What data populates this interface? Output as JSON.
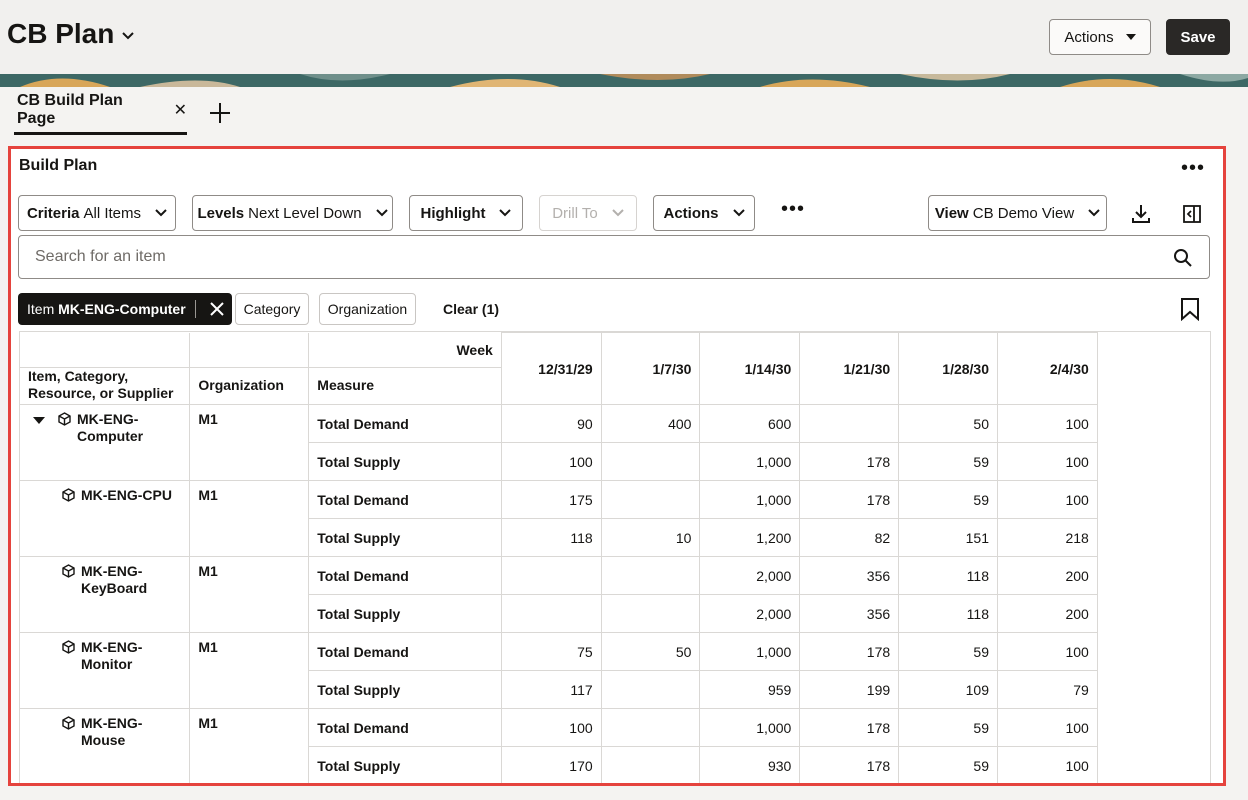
{
  "header": {
    "title": "CB Plan",
    "actions_label": "Actions",
    "save_label": "Save"
  },
  "tabs": [
    {
      "label": "CB Build Plan Page",
      "active": true
    }
  ],
  "panel": {
    "title": "Build Plan",
    "toolbar": {
      "criteria_label": "Criteria",
      "criteria_value": "All Items",
      "levels_label": "Levels",
      "levels_value": "Next Level Down",
      "highlight_label": "Highlight",
      "drill_to_label": "Drill To",
      "actions_label": "Actions",
      "view_label": "View",
      "view_value": "CB Demo View"
    },
    "search": {
      "placeholder": "Search for an item",
      "value": ""
    },
    "filters": {
      "active_chip_label": "Item",
      "active_chip_value": "MK-ENG-Computer",
      "category_label": "Category",
      "organization_label": "Organization",
      "clear_label": "Clear (1)"
    }
  },
  "grid": {
    "week_label": "Week",
    "col_item": [
      "Item, Category,",
      "Resource, or Supplier"
    ],
    "col_org": "Organization",
    "col_measure": "Measure",
    "weeks": [
      "12/31/29",
      "1/7/30",
      "1/14/30",
      "1/21/30",
      "1/28/30",
      "2/4/30"
    ],
    "rows": [
      {
        "item": [
          "MK-ENG-",
          "Computer"
        ],
        "org": "M1",
        "expanded": true,
        "demand": [
          "90",
          "400",
          "600",
          "",
          "50",
          "100"
        ],
        "supply": [
          "100",
          "",
          "1,000",
          "178",
          "59",
          "100"
        ]
      },
      {
        "item": [
          "MK-ENG-CPU"
        ],
        "org": "M1",
        "demand": [
          "175",
          "",
          "1,000",
          "178",
          "59",
          "100"
        ],
        "supply": [
          "118",
          "10",
          "1,200",
          "82",
          "151",
          "218"
        ]
      },
      {
        "item": [
          "MK-ENG-",
          "KeyBoard"
        ],
        "org": "M1",
        "demand": [
          "",
          "",
          "2,000",
          "356",
          "118",
          "200"
        ],
        "supply": [
          "",
          "",
          "2,000",
          "356",
          "118",
          "200"
        ]
      },
      {
        "item": [
          "MK-ENG-",
          "Monitor"
        ],
        "org": "M1",
        "demand": [
          "75",
          "50",
          "1,000",
          "178",
          "59",
          "100"
        ],
        "supply": [
          "117",
          "",
          "959",
          "199",
          "109",
          "79"
        ]
      },
      {
        "item": [
          "MK-ENG-",
          "Mouse"
        ],
        "org": "M1",
        "demand": [
          "100",
          "",
          "1,000",
          "178",
          "59",
          "100"
        ],
        "supply": [
          "170",
          "",
          "930",
          "178",
          "59",
          "100"
        ]
      }
    ],
    "measure_demand": "Total Demand",
    "measure_supply": "Total Supply"
  }
}
